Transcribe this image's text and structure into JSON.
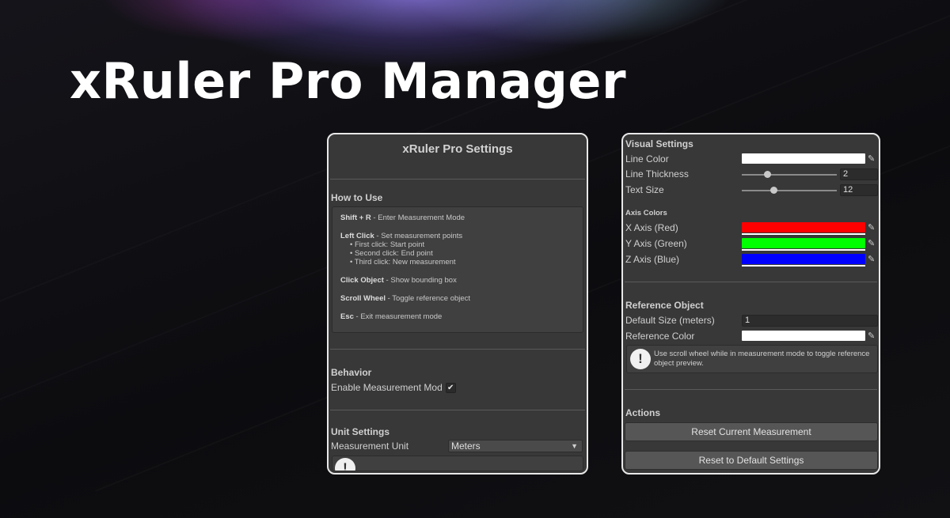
{
  "hero": {
    "title": "xRuler Pro Manager"
  },
  "left_panel": {
    "title": "xRuler Pro Settings",
    "how_to_use": {
      "heading": "How to Use",
      "shortcut_key": "Shift + R",
      "shortcut_desc": " - Enter Measurement Mode",
      "left_click_key": "Left Click",
      "left_click_desc": " - Set measurement points",
      "first_click": "• First click: Start point",
      "second_click": "• Second click: End point",
      "third_click": "• Third click: New measurement",
      "click_object_key": "Click Object",
      "click_object_desc": " - Show bounding box",
      "scroll_key": "Scroll Wheel",
      "scroll_desc": " - Toggle reference object",
      "esc_key": "Esc",
      "esc_desc": " - Exit measurement mode"
    },
    "behavior": {
      "heading": "Behavior",
      "enable_label": "Enable Measurement Mod",
      "enable_check": "✔"
    },
    "unit_settings": {
      "heading": "Unit Settings",
      "unit_label": "Measurement Unit",
      "unit_value": "Meters",
      "dropdown_arrow": "▼",
      "info_glyph": "!"
    }
  },
  "right_panel": {
    "visual_settings": {
      "heading": "Visual Settings",
      "line_color_label": "Line Color",
      "line_thickness_label": "Line Thickness",
      "line_thickness_value": "2",
      "text_size_label": "Text Size",
      "text_size_value": "12"
    },
    "axis_colors": {
      "heading": "Axis Colors",
      "x_label": "X Axis (Red)",
      "y_label": "Y Axis (Green)",
      "z_label": "Z Axis (Blue)"
    },
    "reference_object": {
      "heading": "Reference Object",
      "size_label": "Default Size (meters)",
      "size_value": "1",
      "color_label": "Reference Color",
      "info_glyph": "!",
      "info_text": "Use scroll wheel while in measurement mode to toggle reference object preview."
    },
    "actions": {
      "heading": "Actions",
      "reset_current": "Reset Current Measurement",
      "reset_default": "Reset to Default Settings"
    },
    "picker_glyph": "✎"
  },
  "colors": {
    "line_color": "#ffffff",
    "x_axis": "#ff0000",
    "y_axis": "#00ff00",
    "z_axis": "#0000ff",
    "reference_color": "#ffffff"
  },
  "sliders": {
    "line_thickness_fraction": 0.27,
    "text_size_fraction": 0.34
  }
}
